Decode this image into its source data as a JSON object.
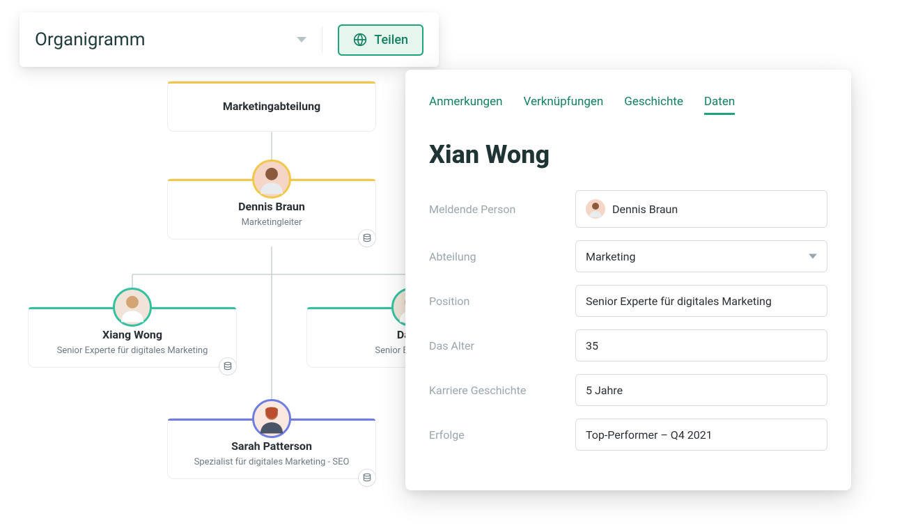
{
  "toolbar": {
    "title": "Organigramm",
    "share_label": "Teilen"
  },
  "org": {
    "department": {
      "name": "Marketingabteilung",
      "color": "yellow"
    },
    "lead": {
      "name": "Dennis Braun",
      "role": "Marketingleiter",
      "color": "yellow"
    },
    "children": [
      {
        "name": "Xiang Wong",
        "role": "Senior Experte für digitales Marketing",
        "color": "teal"
      },
      {
        "name": "David",
        "role": "Senior Experte für",
        "color": "teal"
      },
      {
        "name": "Sarah Patterson",
        "role": "Spezialist für digitales Marketing - SEO",
        "color": "blue"
      }
    ]
  },
  "panel": {
    "tabs": [
      "Anmerkungen",
      "Verknüpfungen",
      "Geschichte",
      "Daten"
    ],
    "active_tab": "Daten",
    "title": "Xian Wong",
    "fields": {
      "reporting_label": "Meldende Person",
      "reporting_value": "Dennis Braun",
      "department_label": "Abteilung",
      "department_value": "Marketing",
      "position_label": "Position",
      "position_value": "Senior Experte für digitales Marketing",
      "age_label": "Das Alter",
      "age_value": "35",
      "history_label": "Karriere Geschichte",
      "history_value": "5 Jahre",
      "achievements_label": "Erfolge",
      "achievements_value": "Top-Performer – Q4 2021"
    }
  }
}
